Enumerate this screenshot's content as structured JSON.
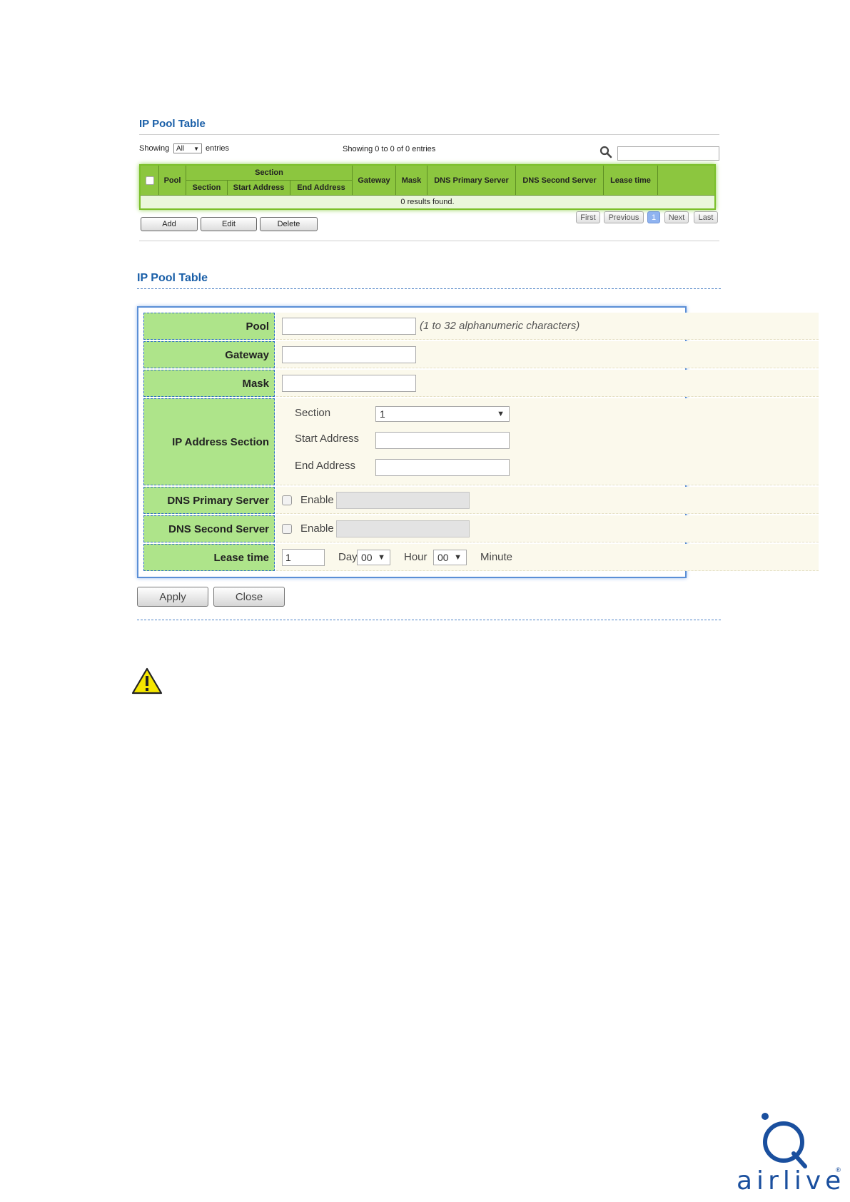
{
  "pool_table": {
    "title": "IP Pool Table",
    "showing_label": "Showing",
    "entries_select": "All",
    "entries_label": "entries",
    "showing_status": "Showing 0 to 0 of 0 entries",
    "search_placeholder": "",
    "columns": {
      "pool": "Pool",
      "section_group": "Section",
      "section": "Section",
      "start_address": "Start Address",
      "end_address": "End Address",
      "gateway": "Gateway",
      "mask": "Mask",
      "dns_primary": "DNS Primary Server",
      "dns_second": "DNS Second Server",
      "lease_time": "Lease time"
    },
    "empty_message": "0 results found.",
    "buttons": {
      "add": "Add",
      "edit": "Edit",
      "delete": "Delete"
    },
    "pagination": {
      "first": "First",
      "previous": "Previous",
      "current": "1",
      "next": "Next",
      "last": "Last"
    }
  },
  "pool_form": {
    "title": "IP Pool Table",
    "pool_label": "Pool",
    "pool_value": "",
    "pool_hint": "(1 to 32 alphanumeric characters)",
    "gateway_label": "Gateway",
    "gateway_value": "",
    "mask_label": "Mask",
    "mask_value": "",
    "ip_section_label": "IP Address Section",
    "section_label": "Section",
    "section_value": "1",
    "start_address_label": "Start Address",
    "start_address_value": "",
    "end_address_label": "End Address",
    "end_address_value": "",
    "dns_primary_label": "DNS Primary Server",
    "dns_primary_enable": "Enable",
    "dns_second_label": "DNS Second Server",
    "dns_second_enable": "Enable",
    "lease_label": "Lease time",
    "lease_day_value": "1",
    "day_label": "Day",
    "hour_value": "00",
    "hour_label": "Hour",
    "minute_value": "00",
    "minute_label": "Minute",
    "apply": "Apply",
    "close": "Close"
  },
  "brand": {
    "logo_text": "airlive",
    "accent_color": "#1a5fa8"
  },
  "icons": {
    "search": "search-icon",
    "warning": "warning-icon",
    "dropdown": "chevron-down-icon"
  }
}
